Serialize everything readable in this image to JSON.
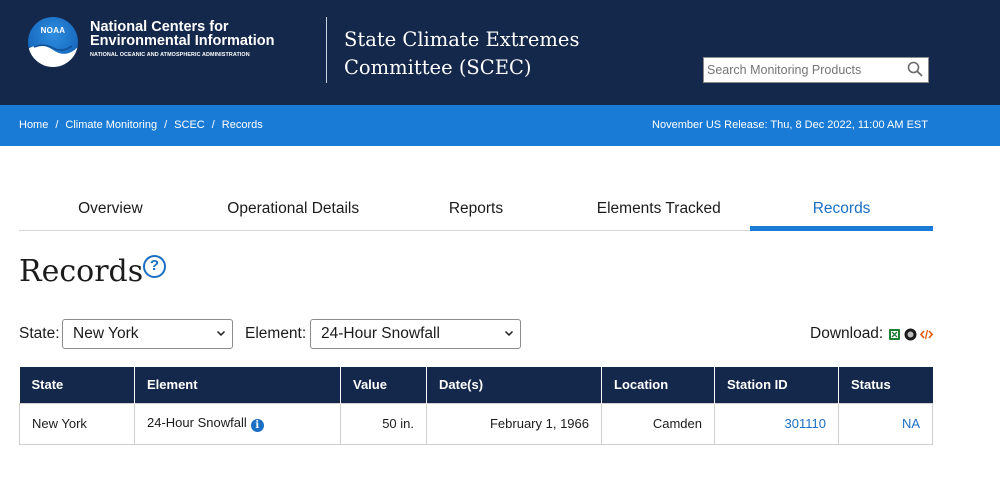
{
  "header": {
    "org_line1": "National Centers for",
    "org_line2": "Environmental Information",
    "org_sub": "NATIONAL OCEANIC AND ATMOSPHERIC ADMINISTRATION",
    "logo_text": "NOAA",
    "site_title_line1": "State Climate Extremes",
    "site_title_line2": "Committee (SCEC)",
    "search_placeholder": "Search Monitoring Products"
  },
  "breadcrumb": {
    "items": [
      "Home",
      "Climate Monitoring",
      "SCEC",
      "Records"
    ],
    "separator": "/",
    "release": "November US Release: Thu, 8 Dec 2022, 11:00 AM EST"
  },
  "tabs": [
    {
      "label": "Overview",
      "active": false
    },
    {
      "label": "Operational Details",
      "active": false
    },
    {
      "label": "Reports",
      "active": false
    },
    {
      "label": "Elements Tracked",
      "active": false
    },
    {
      "label": "Records",
      "active": true
    }
  ],
  "page": {
    "title": "Records",
    "help_symbol": "?"
  },
  "filters": {
    "state_label": "State:",
    "state_value": "New York",
    "element_label": "Element:",
    "element_value": "24-Hour Snowfall",
    "download_label": "Download:"
  },
  "download_icons": [
    "excel-icon",
    "csv-icon",
    "code-icon"
  ],
  "table": {
    "headers": [
      "State",
      "Element",
      "Value",
      "Date(s)",
      "Location",
      "Station ID",
      "Status"
    ],
    "rows": [
      {
        "state": "New York",
        "element": "24-Hour Snowfall",
        "value": "50 in.",
        "date": "February 1, 1966",
        "location": "Camden",
        "station_id": "301110",
        "status": "NA"
      }
    ]
  },
  "colors": {
    "header_bg": "#14284b",
    "breadcrumb_bg": "#1a7bd6",
    "accent": "#1a6fc4"
  }
}
